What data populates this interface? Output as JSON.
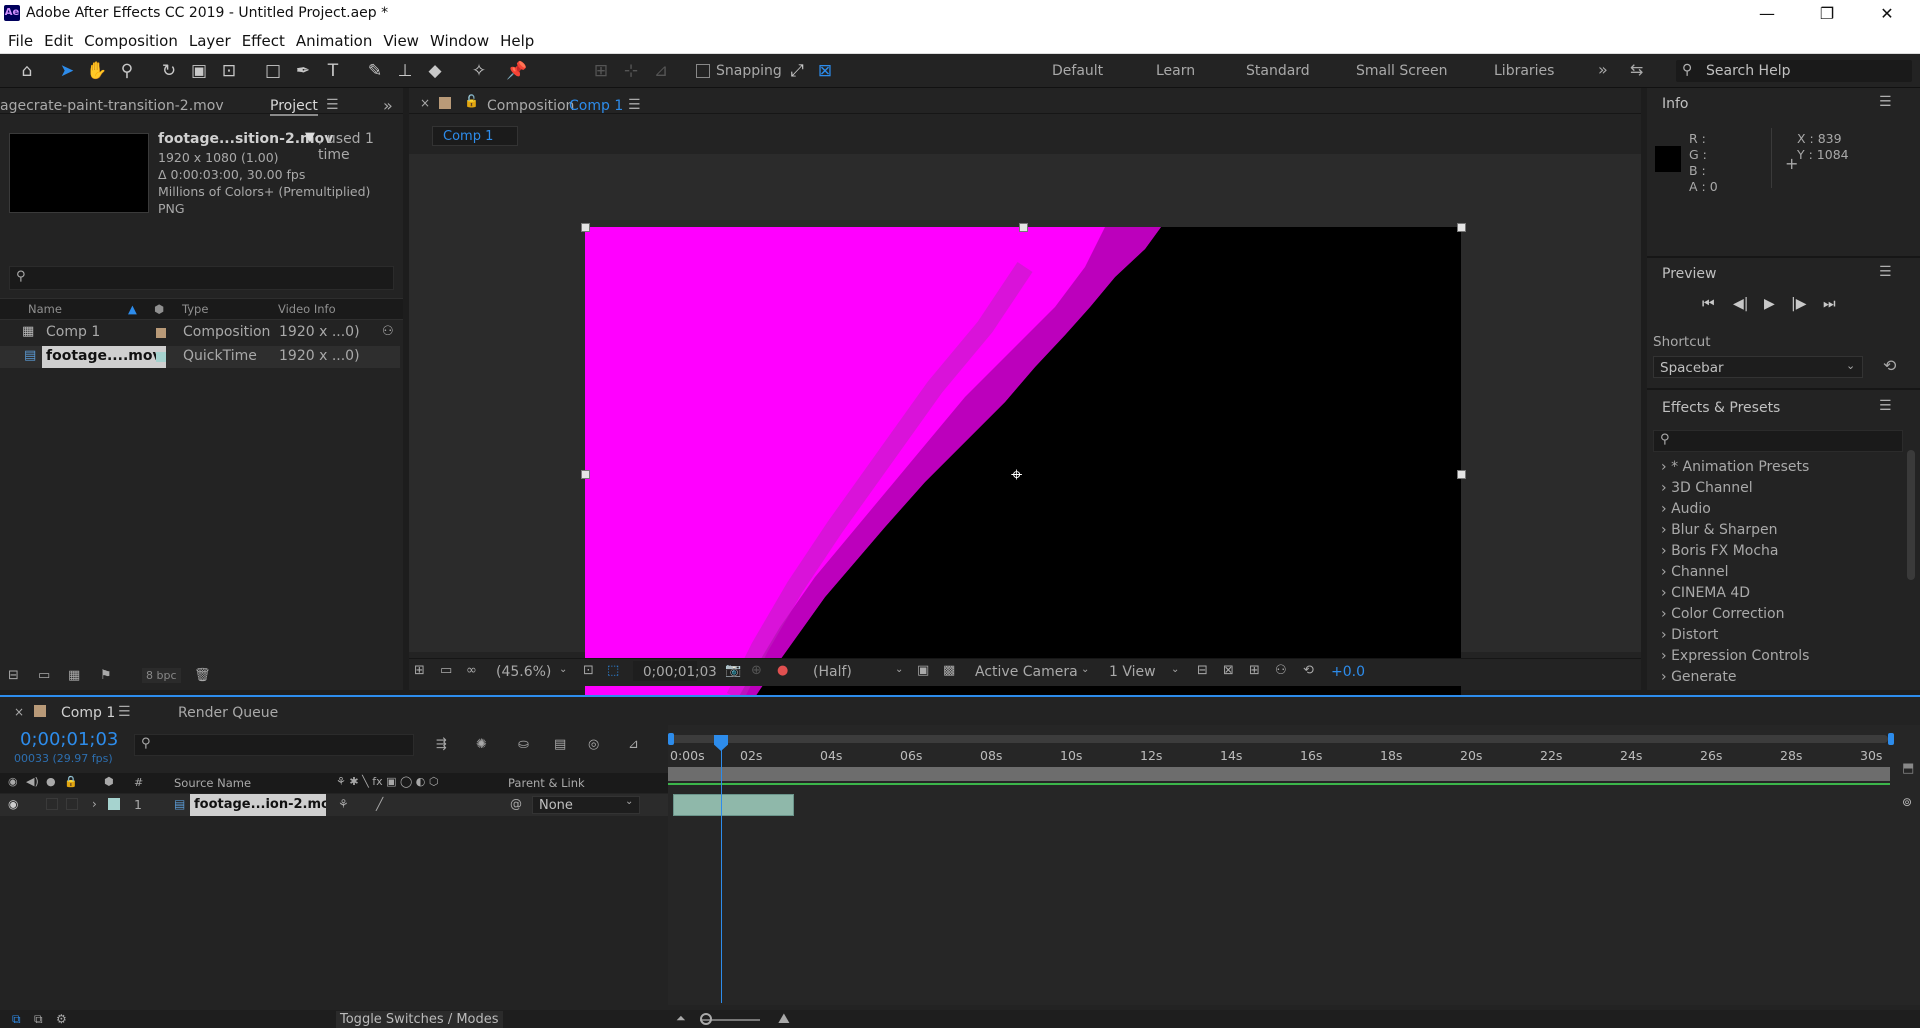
{
  "window": {
    "app_badge": "Ae",
    "title": "Adobe After Effects CC 2019 - Untitled Project.aep *",
    "controls": [
      "—",
      "❐",
      "✕"
    ]
  },
  "menu": [
    "File",
    "Edit",
    "Composition",
    "Layer",
    "Effect",
    "Animation",
    "View",
    "Window",
    "Help"
  ],
  "toolbar": {
    "snapping_label": "Snapping",
    "workspaces": [
      "Default",
      "Learn",
      "Standard",
      "Small Screen",
      "Libraries"
    ],
    "search_placeholder": "Search Help"
  },
  "project": {
    "source_tab": "agecrate-paint-transition-2.mov",
    "project_tab": "Project",
    "selected_name": "footage...sition-2.mov",
    "used": ", used 1 time",
    "info_lines": [
      "1920 x 1080 (1.00)",
      "Δ 0:00:03:00, 30.00 fps",
      "Millions of Colors+ (Premultiplied)",
      "PNG"
    ],
    "columns": {
      "name": "Name",
      "type": "Type",
      "video_info": "Video Info"
    },
    "items": [
      {
        "name": "Comp 1",
        "type": "Composition",
        "info": "1920 x ...0)",
        "label_color": "#b99a78"
      },
      {
        "name": "footage....mov",
        "type": "QuickTime",
        "info": "1920 x ...0)",
        "label_color": "#a6d3cf"
      }
    ],
    "bpc": "8 bpc"
  },
  "viewer": {
    "panel_label": "Composition",
    "comp_name": "Comp 1",
    "tab": "Comp 1",
    "zoom": "(45.6%)",
    "timecode": "0;00;01;03",
    "resolution": "(Half)",
    "camera": "Active Camera",
    "views": "1 View",
    "exposure": "+0.0"
  },
  "info_panel": {
    "title": "Info",
    "r": "R :",
    "g": "G :",
    "b": "B :",
    "a": "A :  0",
    "x": "X : 839",
    "y": "Y : 1084"
  },
  "preview_panel": {
    "title": "Preview",
    "shortcut_label": "Shortcut",
    "shortcut_value": "Spacebar"
  },
  "effects_panel": {
    "title": "Effects & Presets",
    "items": [
      "* Animation Presets",
      "3D Channel",
      "Audio",
      "Blur & Sharpen",
      "Boris FX Mocha",
      "Channel",
      "CINEMA 4D",
      "Color Correction",
      "Distort",
      "Expression Controls",
      "Generate"
    ]
  },
  "timeline": {
    "comp_tab": "Comp 1",
    "render_tab": "Render Queue",
    "timecode": "0;00;01;03",
    "frame_info": "00033 (29.97 fps)",
    "col_source": "Source Name",
    "col_parent": "Parent & Link",
    "col_num": "#",
    "layer": {
      "num": "1",
      "name": "footage...ion-2.mov",
      "parent": "None"
    },
    "ticks": [
      "0:00s",
      "02s",
      "04s",
      "06s",
      "08s",
      "10s",
      "12s",
      "14s",
      "16s",
      "18s",
      "20s",
      "22s",
      "24s",
      "26s",
      "28s",
      "30s"
    ],
    "toggle_label": "Toggle Switches / Modes"
  },
  "colors": {
    "accent": "#2d8ceb",
    "magenta": "#ff00ff",
    "layer_bar": "#8fb8aa"
  }
}
